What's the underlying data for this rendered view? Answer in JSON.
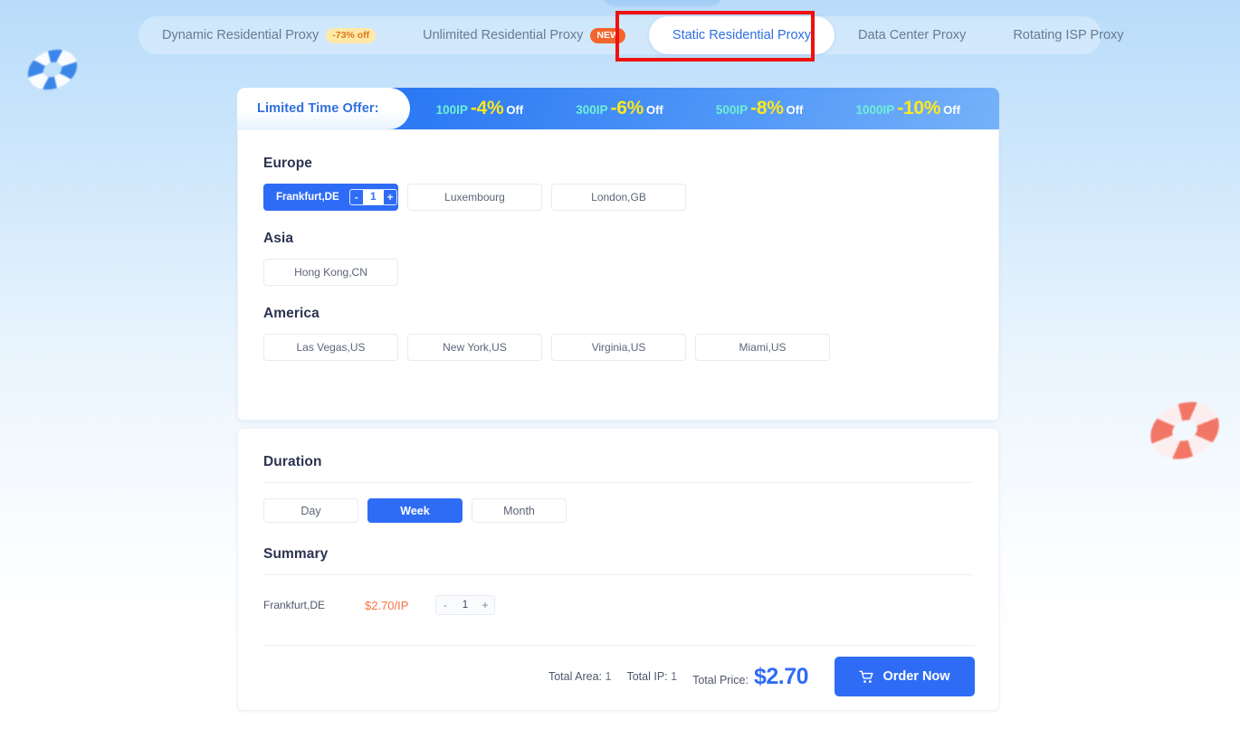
{
  "theme": {
    "accent": "#2f6cf6",
    "price_accent": "#f9703e",
    "tier_ip_color": "#6ff0d6",
    "tier_pct_color": "#ffe81c",
    "highlight_box_color": "#ef1010"
  },
  "tabs": [
    {
      "label": "Dynamic Residential Proxy",
      "badge": "-73% off",
      "badge_type": "off",
      "active": false
    },
    {
      "label": "Unlimited Residential Proxy",
      "badge": "NEW",
      "badge_type": "new",
      "active": false
    },
    {
      "label": "Static Residential Proxy",
      "badge": null,
      "badge_type": null,
      "active": true
    },
    {
      "label": "Data Center Proxy",
      "badge": null,
      "badge_type": null,
      "active": false
    },
    {
      "label": "Rotating ISP Proxy",
      "badge": null,
      "badge_type": null,
      "active": false
    }
  ],
  "promo": {
    "label": "Limited Time Offer:",
    "tiers": [
      {
        "ip": "100IP",
        "pct": "-4%",
        "off": "Off"
      },
      {
        "ip": "300IP",
        "pct": "-6%",
        "off": "Off"
      },
      {
        "ip": "500IP",
        "pct": "-8%",
        "off": "Off"
      },
      {
        "ip": "1000IP",
        "pct": "-10%",
        "off": "Off"
      }
    ]
  },
  "locations": {
    "groups": [
      {
        "title": "Europe",
        "items": [
          {
            "name": "Frankfurt,DE",
            "selected": true,
            "qty": "1",
            "minus": "-",
            "plus": "+"
          },
          {
            "name": "Luxembourg",
            "selected": false
          },
          {
            "name": "London,GB",
            "selected": false
          }
        ]
      },
      {
        "title": "Asia",
        "items": [
          {
            "name": "Hong Kong,CN",
            "selected": false
          }
        ]
      },
      {
        "title": "America",
        "items": [
          {
            "name": "Las Vegas,US",
            "selected": false
          },
          {
            "name": "New York,US",
            "selected": false
          },
          {
            "name": "Virginia,US",
            "selected": false
          },
          {
            "name": "Miami,US",
            "selected": false
          }
        ]
      }
    ]
  },
  "duration": {
    "title": "Duration",
    "options": [
      {
        "label": "Day",
        "selected": false
      },
      {
        "label": "Week",
        "selected": true
      },
      {
        "label": "Month",
        "selected": false
      }
    ]
  },
  "summary": {
    "title": "Summary",
    "rows": [
      {
        "name": "Frankfurt,DE",
        "price": "$2.70/IP",
        "minus": "-",
        "qty": "1",
        "plus": "+"
      }
    ]
  },
  "totals": {
    "area_label": "Total Area:",
    "area_value": "1",
    "ip_label": "Total IP:",
    "ip_value": "1",
    "price_label": "Total Price:",
    "price_value": "$2.70",
    "order_label": "Order Now"
  }
}
